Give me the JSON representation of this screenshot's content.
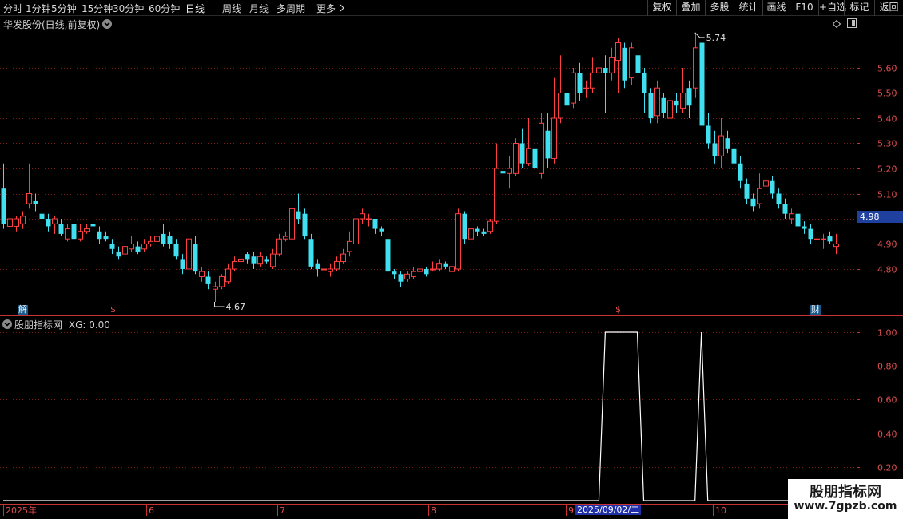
{
  "toolbar": {
    "timeframes": [
      "分时",
      "1分钟",
      "5分钟",
      "15分钟",
      "30分钟",
      "60分钟",
      "日线",
      "周线",
      "月线",
      "多周期",
      "更多"
    ],
    "active_timeframe": "日线",
    "right_buttons": [
      "复权",
      "叠加",
      "多股",
      "统计",
      "画线",
      "F10",
      "+自选",
      "标记",
      "返回"
    ]
  },
  "main_panel": {
    "title": "华发股份(日线,前复权)",
    "current_price": "4.98",
    "high_label": "5.74",
    "low_label": "4.67",
    "markers": [
      {
        "text": "解",
        "color": "#40e0f0"
      },
      {
        "text": "$",
        "color": "#e05050"
      },
      {
        "text": "$",
        "color": "#e05050"
      },
      {
        "text": "财",
        "color": "#40e0f0"
      }
    ]
  },
  "indicator_panel": {
    "title": "股朋指标网",
    "value_text": "XG: 0.00"
  },
  "colors": {
    "up": "#ff4040",
    "down": "#40e0f0",
    "grid": "#7a1a1a",
    "axis": "#c83232",
    "price_tag": "#2040a0"
  },
  "chart_data": [
    {
      "type": "candlestick",
      "title": "华发股份(日线,前复权)",
      "yticks": [
        4.8,
        4.9,
        5.0,
        5.1,
        5.2,
        5.3,
        5.4,
        5.5,
        5.6
      ],
      "ytick_labels": [
        "4.80",
        "4.90",
        "",
        "5.10",
        "5.20",
        "5.30",
        "5.40",
        "5.50",
        "5.60"
      ],
      "ylim": [
        4.62,
        5.78
      ],
      "xticks": [
        "2025年",
        "6",
        "7",
        "8",
        "9",
        "10"
      ],
      "selected_date": "2025/09/02/二",
      "candles": [
        [
          5.12,
          4.98,
          5.22,
          4.96
        ],
        [
          4.97,
          5.0,
          5.02,
          4.95
        ],
        [
          4.97,
          5.0,
          5.01,
          4.95
        ],
        [
          4.98,
          5.01,
          5.03,
          4.96
        ],
        [
          5.06,
          5.1,
          5.22,
          5.04
        ],
        [
          5.07,
          5.06,
          5.1,
          5.03
        ],
        [
          5.02,
          5.0,
          5.04,
          4.98
        ],
        [
          5.0,
          4.97,
          5.02,
          4.95
        ],
        [
          4.98,
          5.0,
          5.01,
          4.94
        ],
        [
          4.98,
          4.94,
          5.0,
          4.93
        ],
        [
          4.92,
          4.96,
          4.98,
          4.91
        ],
        [
          4.98,
          4.92,
          5.0,
          4.9
        ],
        [
          4.92,
          4.95,
          4.98,
          4.91
        ],
        [
          4.95,
          4.96,
          4.98,
          4.94
        ],
        [
          4.98,
          4.97,
          5.0,
          4.95
        ],
        [
          4.95,
          4.92,
          4.97,
          4.9
        ],
        [
          4.93,
          4.92,
          4.95,
          4.91
        ],
        [
          4.9,
          4.88,
          4.92,
          4.86
        ],
        [
          4.87,
          4.85,
          4.89,
          4.84
        ],
        [
          4.86,
          4.89,
          4.91,
          4.85
        ],
        [
          4.88,
          4.9,
          4.93,
          4.87
        ],
        [
          4.89,
          4.87,
          4.91,
          4.86
        ],
        [
          4.88,
          4.9,
          4.92,
          4.87
        ],
        [
          4.9,
          4.91,
          4.93,
          4.89
        ],
        [
          4.91,
          4.93,
          4.95,
          4.9
        ],
        [
          4.94,
          4.9,
          4.98,
          4.89
        ],
        [
          4.93,
          4.9,
          4.95,
          4.88
        ],
        [
          4.9,
          4.85,
          4.92,
          4.84
        ],
        [
          4.84,
          4.8,
          4.86,
          4.78
        ],
        [
          4.8,
          4.92,
          4.94,
          4.79
        ],
        [
          4.9,
          4.79,
          4.93,
          4.78
        ],
        [
          4.77,
          4.79,
          4.81,
          4.75
        ],
        [
          4.77,
          4.74,
          4.79,
          4.72
        ],
        [
          4.72,
          4.73,
          4.75,
          4.67
        ],
        [
          4.73,
          4.77,
          4.78,
          4.72
        ],
        [
          4.75,
          4.8,
          4.82,
          4.74
        ],
        [
          4.8,
          4.83,
          4.85,
          4.79
        ],
        [
          4.83,
          4.84,
          4.88,
          4.81
        ],
        [
          4.86,
          4.84,
          4.87,
          4.82
        ],
        [
          4.85,
          4.82,
          4.87,
          4.8
        ],
        [
          4.82,
          4.85,
          4.87,
          4.81
        ],
        [
          4.84,
          4.83,
          4.85,
          4.82
        ],
        [
          4.81,
          4.86,
          4.88,
          4.8
        ],
        [
          4.86,
          4.92,
          4.94,
          4.85
        ],
        [
          4.92,
          4.93,
          4.95,
          4.91
        ],
        [
          4.92,
          5.04,
          5.06,
          4.9
        ],
        [
          5.03,
          5.0,
          5.1,
          4.98
        ],
        [
          5.02,
          4.93,
          5.04,
          4.92
        ],
        [
          4.92,
          4.81,
          4.94,
          4.8
        ],
        [
          4.82,
          4.8,
          4.84,
          4.77
        ],
        [
          4.8,
          4.8,
          4.82,
          4.76
        ],
        [
          4.79,
          4.8,
          4.82,
          4.77
        ],
        [
          4.8,
          4.83,
          4.85,
          4.79
        ],
        [
          4.83,
          4.86,
          4.88,
          4.82
        ],
        [
          4.87,
          4.91,
          4.95,
          4.85
        ],
        [
          4.9,
          5.0,
          5.06,
          4.89
        ],
        [
          5.0,
          5.02,
          5.04,
          4.98
        ],
        [
          5.0,
          5.0,
          5.02,
          4.97
        ],
        [
          5.0,
          4.96,
          5.0,
          4.94
        ],
        [
          4.96,
          4.95,
          4.97,
          4.93
        ],
        [
          4.92,
          4.79,
          4.93,
          4.78
        ],
        [
          4.79,
          4.78,
          4.8,
          4.76
        ],
        [
          4.78,
          4.75,
          4.79,
          4.73
        ],
        [
          4.76,
          4.78,
          4.79,
          4.75
        ],
        [
          4.77,
          4.79,
          4.81,
          4.76
        ],
        [
          4.79,
          4.8,
          4.81,
          4.78
        ],
        [
          4.8,
          4.78,
          4.81,
          4.77
        ],
        [
          4.8,
          4.8,
          4.83,
          4.79
        ],
        [
          4.8,
          4.82,
          4.84,
          4.79
        ],
        [
          4.82,
          4.81,
          4.83,
          4.8
        ],
        [
          4.79,
          4.81,
          4.83,
          4.78
        ],
        [
          4.8,
          5.02,
          5.04,
          4.79
        ],
        [
          5.02,
          4.92,
          5.03,
          4.9
        ],
        [
          4.92,
          4.96,
          4.99,
          4.91
        ],
        [
          4.96,
          4.95,
          4.97,
          4.93
        ],
        [
          4.95,
          4.94,
          4.96,
          4.93
        ],
        [
          4.95,
          4.99,
          5.0,
          4.94
        ],
        [
          4.99,
          5.2,
          5.3,
          4.98
        ],
        [
          5.19,
          5.18,
          5.22,
          5.15
        ],
        [
          5.18,
          5.2,
          5.25,
          5.12
        ],
        [
          5.18,
          5.3,
          5.32,
          5.17
        ],
        [
          5.3,
          5.22,
          5.36,
          5.2
        ],
        [
          5.22,
          5.28,
          5.4,
          5.21
        ],
        [
          5.28,
          5.2,
          5.38,
          5.18
        ],
        [
          5.18,
          5.38,
          5.42,
          5.16
        ],
        [
          5.35,
          5.24,
          5.42,
          5.2
        ],
        [
          5.24,
          5.4,
          5.56,
          5.22
        ],
        [
          5.4,
          5.5,
          5.65,
          5.38
        ],
        [
          5.5,
          5.45,
          5.55,
          5.42
        ],
        [
          5.46,
          5.58,
          5.6,
          5.44
        ],
        [
          5.58,
          5.5,
          5.62,
          5.47
        ],
        [
          5.52,
          5.52,
          5.55,
          5.48
        ],
        [
          5.52,
          5.58,
          5.64,
          5.5
        ],
        [
          5.58,
          5.6,
          5.64,
          5.55
        ],
        [
          5.6,
          5.58,
          5.65,
          5.42
        ],
        [
          5.58,
          5.64,
          5.68,
          5.55
        ],
        [
          5.63,
          5.7,
          5.72,
          5.5
        ],
        [
          5.68,
          5.55,
          5.7,
          5.52
        ],
        [
          5.56,
          5.68,
          5.7,
          5.53
        ],
        [
          5.65,
          5.58,
          5.67,
          5.5
        ],
        [
          5.58,
          5.5,
          5.6,
          5.42
        ],
        [
          5.5,
          5.4,
          5.52,
          5.38
        ],
        [
          5.41,
          5.52,
          5.55,
          5.38
        ],
        [
          5.48,
          5.42,
          5.5,
          5.4
        ],
        [
          5.4,
          5.47,
          5.55,
          5.35
        ],
        [
          5.47,
          5.45,
          5.5,
          5.42
        ],
        [
          5.44,
          5.5,
          5.6,
          5.42
        ],
        [
          5.52,
          5.45,
          5.55,
          5.4
        ],
        [
          5.52,
          5.68,
          5.74,
          5.48
        ],
        [
          5.7,
          5.37,
          5.72,
          5.35
        ],
        [
          5.37,
          5.3,
          5.42,
          5.28
        ],
        [
          5.3,
          5.25,
          5.35,
          5.22
        ],
        [
          5.25,
          5.33,
          5.4,
          5.2
        ],
        [
          5.32,
          5.28,
          5.35,
          5.26
        ],
        [
          5.28,
          5.22,
          5.3,
          5.2
        ],
        [
          5.22,
          5.15,
          5.25,
          5.12
        ],
        [
          5.14,
          5.08,
          5.16,
          5.06
        ],
        [
          5.08,
          5.05,
          5.1,
          5.03
        ],
        [
          5.06,
          5.12,
          5.18,
          5.04
        ],
        [
          5.13,
          5.15,
          5.22,
          5.05
        ],
        [
          5.15,
          5.1,
          5.17,
          5.08
        ],
        [
          5.1,
          5.06,
          5.12,
          5.04
        ],
        [
          5.06,
          5.02,
          5.08,
          5.0
        ],
        [
          5.0,
          5.02,
          5.04,
          4.98
        ],
        [
          5.02,
          4.97,
          5.04,
          4.95
        ],
        [
          4.97,
          4.96,
          4.99,
          4.94
        ],
        [
          4.96,
          4.92,
          4.98,
          4.9
        ],
        [
          4.92,
          4.92,
          4.94,
          4.9
        ],
        [
          4.92,
          4.92,
          4.94,
          4.88
        ],
        [
          4.93,
          4.91,
          4.95,
          4.9
        ],
        [
          4.89,
          4.9,
          4.94,
          4.86
        ]
      ]
    },
    {
      "type": "line",
      "title": "股朋指标网",
      "series": [
        {
          "name": "XG"
        }
      ],
      "yticks": [
        0.2,
        0.4,
        0.6,
        0.8,
        1.0
      ],
      "ytick_labels": [
        "0.20",
        "0.40",
        "0.60",
        "0.80",
        "1.00"
      ],
      "ylim": [
        0.0,
        1.04
      ],
      "values": [
        0,
        0,
        0,
        0,
        0,
        0,
        0,
        0,
        0,
        0,
        0,
        0,
        0,
        0,
        0,
        0,
        0,
        0,
        0,
        0,
        0,
        0,
        0,
        0,
        0,
        0,
        0,
        0,
        0,
        0,
        0,
        0,
        0,
        0,
        0,
        0,
        0,
        0,
        0,
        0,
        0,
        0,
        0,
        0,
        0,
        0,
        0,
        0,
        0,
        0,
        0,
        0,
        0,
        0,
        0,
        0,
        0,
        0,
        0,
        0,
        0,
        0,
        0,
        0,
        0,
        0,
        0,
        0,
        0,
        0,
        0,
        0,
        0,
        0,
        0,
        0,
        0,
        0,
        0,
        0,
        0,
        0,
        0,
        0,
        0,
        0,
        0,
        0,
        0,
        0,
        0,
        0,
        0,
        0,
        1,
        1,
        1,
        1,
        1,
        1,
        0,
        0,
        0,
        0,
        0,
        0,
        0,
        0,
        0,
        1,
        0,
        0,
        0,
        0,
        0,
        0,
        0,
        0,
        0,
        0,
        0,
        0,
        0,
        0,
        0,
        0,
        0,
        0,
        0,
        0,
        0,
        0,
        0,
        0,
        0,
        0,
        0
      ]
    }
  ]
}
